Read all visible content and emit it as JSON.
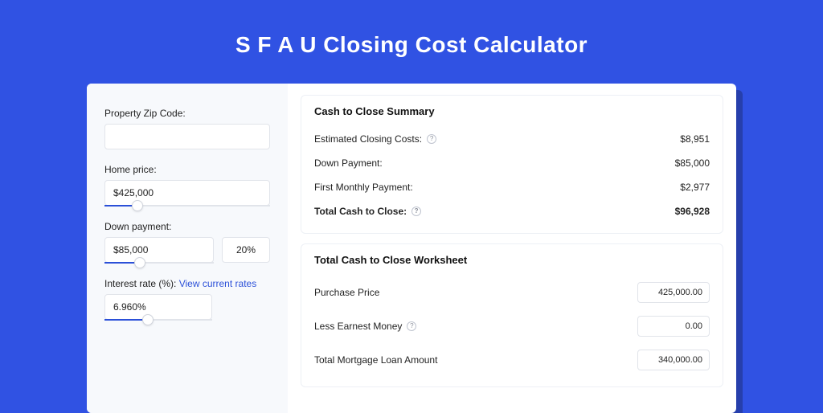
{
  "header": {
    "title": "S F A U Closing Cost Calculator"
  },
  "inputs": {
    "zip_label": "Property Zip Code:",
    "zip_value": "",
    "home_price_label": "Home price:",
    "home_price_value": "$425,000",
    "down_payment_label": "Down payment:",
    "down_payment_value": "$85,000",
    "down_payment_pct": "20%",
    "interest_label": "Interest rate (%):",
    "interest_link": "View current rates",
    "interest_value": "6.960%"
  },
  "summary": {
    "title": "Cash to Close Summary",
    "rows": [
      {
        "label": "Estimated Closing Costs:",
        "value": "$8,951",
        "help": true
      },
      {
        "label": "Down Payment:",
        "value": "$85,000",
        "help": false
      },
      {
        "label": "First Monthly Payment:",
        "value": "$2,977",
        "help": false
      },
      {
        "label": "Total Cash to Close:",
        "value": "$96,928",
        "help": true,
        "bold": true
      }
    ]
  },
  "worksheet": {
    "title": "Total Cash to Close Worksheet",
    "rows": [
      {
        "label": "Purchase Price",
        "value": "425,000.00",
        "help": false
      },
      {
        "label": "Less Earnest Money",
        "value": "0.00",
        "help": true
      },
      {
        "label": "Total Mortgage Loan Amount",
        "value": "340,000.00",
        "help": false
      }
    ]
  },
  "sliders": {
    "home_price_pct": 20,
    "down_payment_pct": 32,
    "interest_pct": 40
  }
}
